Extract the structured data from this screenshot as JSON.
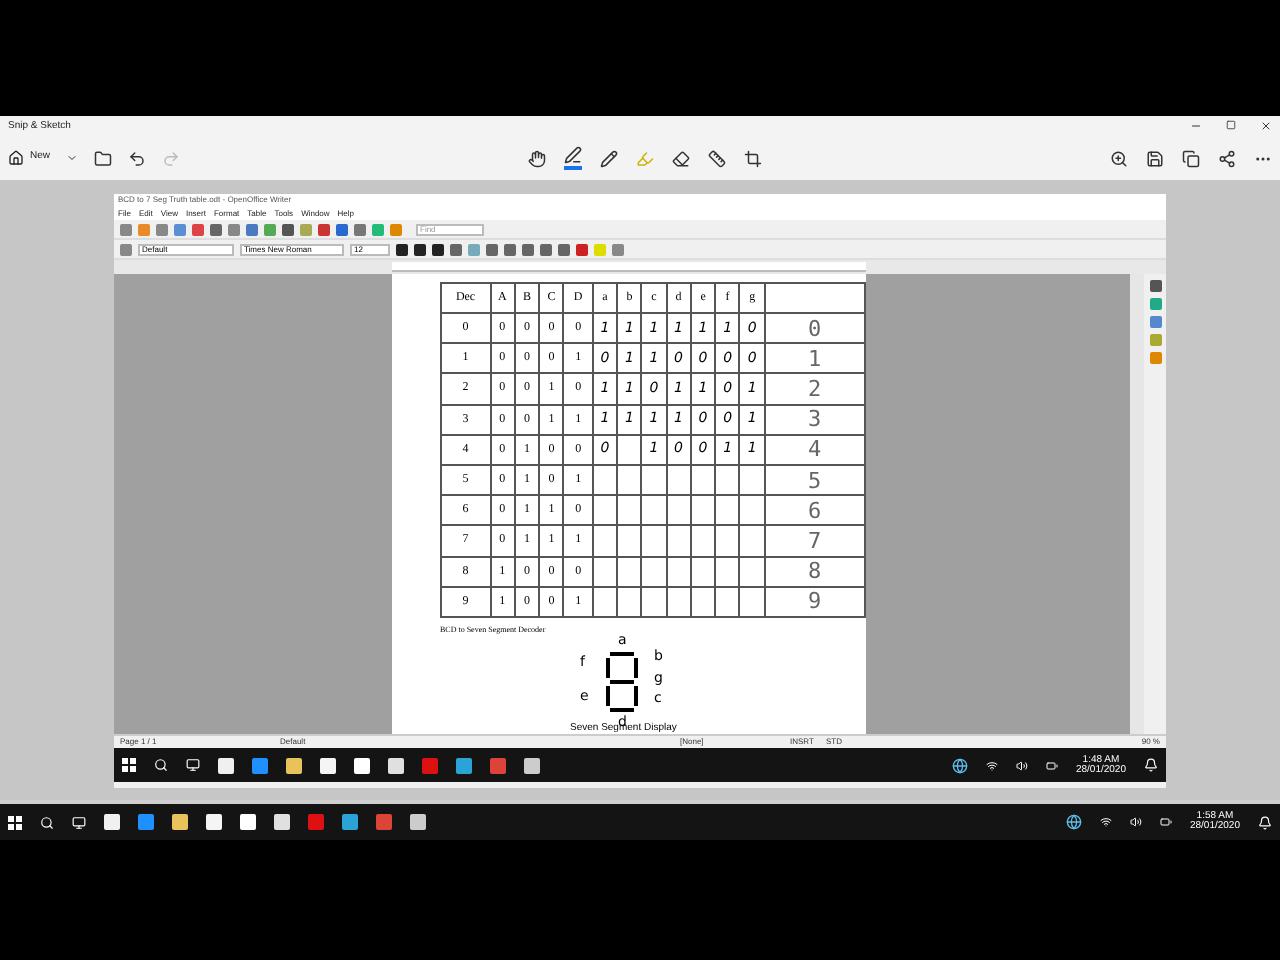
{
  "window": {
    "title": "Snip & Sketch"
  },
  "toolbar": {
    "new_label": "New"
  },
  "writer": {
    "title": "BCD to 7 Seg Truth table.odt - OpenOffice Writer",
    "menu": [
      "File",
      "Edit",
      "View",
      "Insert",
      "Format",
      "Table",
      "Tools",
      "Window",
      "Help"
    ],
    "find_placeholder": "Find",
    "style": "Default",
    "font": "Times New Roman",
    "size": "12",
    "table": {
      "columns": [
        "Dec",
        "A",
        "B",
        "C",
        "D",
        "a",
        "b",
        "c",
        "d",
        "e",
        "f",
        "g"
      ],
      "rows": [
        {
          "dec": "0",
          "bits": [
            "0",
            "0",
            "0",
            "0"
          ],
          "segments": [
            "1",
            "1",
            "1",
            "1",
            "1",
            "1",
            "0"
          ],
          "display": "0"
        },
        {
          "dec": "1",
          "bits": [
            "0",
            "0",
            "0",
            "1"
          ],
          "segments": [
            "0",
            "1",
            "1",
            "0",
            "0",
            "0",
            "0"
          ],
          "display": "1"
        },
        {
          "dec": "2",
          "bits": [
            "0",
            "0",
            "1",
            "0"
          ],
          "segments": [
            "1",
            "1",
            "0",
            "1",
            "1",
            "0",
            "1"
          ],
          "display": "2"
        },
        {
          "dec": "3",
          "bits": [
            "0",
            "0",
            "1",
            "1"
          ],
          "segments": [
            "1",
            "1",
            "1",
            "1",
            "0",
            "0",
            "1"
          ],
          "display": "3"
        },
        {
          "dec": "4",
          "bits": [
            "0",
            "1",
            "0",
            "0"
          ],
          "segments": [
            {
              "kind": "mark",
              "text": "0"
            },
            {
              "kind": "blank"
            },
            {
              "kind": "mark",
              "text": "1"
            },
            {
              "kind": "mark",
              "text": "0"
            },
            {
              "kind": "mark",
              "text": "0"
            },
            {
              "kind": "mark",
              "text": "1"
            },
            {
              "kind": "mark",
              "text": "1"
            }
          ],
          "display": "4"
        },
        {
          "dec": "5",
          "bits": [
            "0",
            "1",
            "0",
            "1"
          ],
          "segments": [],
          "display": "5"
        },
        {
          "dec": "6",
          "bits": [
            "0",
            "1",
            "1",
            "0"
          ],
          "segments": [],
          "display": "6"
        },
        {
          "dec": "7",
          "bits": [
            "0",
            "1",
            "1",
            "1"
          ],
          "segments": [],
          "display": "7"
        },
        {
          "dec": "8",
          "bits": [
            "1",
            "0",
            "0",
            "0"
          ],
          "segments": [],
          "display": "8"
        },
        {
          "dec": "9",
          "bits": [
            "1",
            "0",
            "0",
            "1"
          ],
          "segments": [],
          "display": "9"
        }
      ]
    },
    "caption": "BCD to Seven Segment Decoder",
    "segment_labels": [
      "a",
      "b",
      "c",
      "d",
      "e",
      "f",
      "g"
    ],
    "figure_caption": "Seven Segment Display",
    "status": [
      "Page 1 / 1",
      "Default",
      "[None]",
      "INSRT",
      "STD",
      "90 %"
    ],
    "taskbar_time": "1:48 AM",
    "taskbar_date": "28/01/2020"
  },
  "taskbar": {
    "time": "1:58 AM",
    "date": "28/01/2020"
  }
}
